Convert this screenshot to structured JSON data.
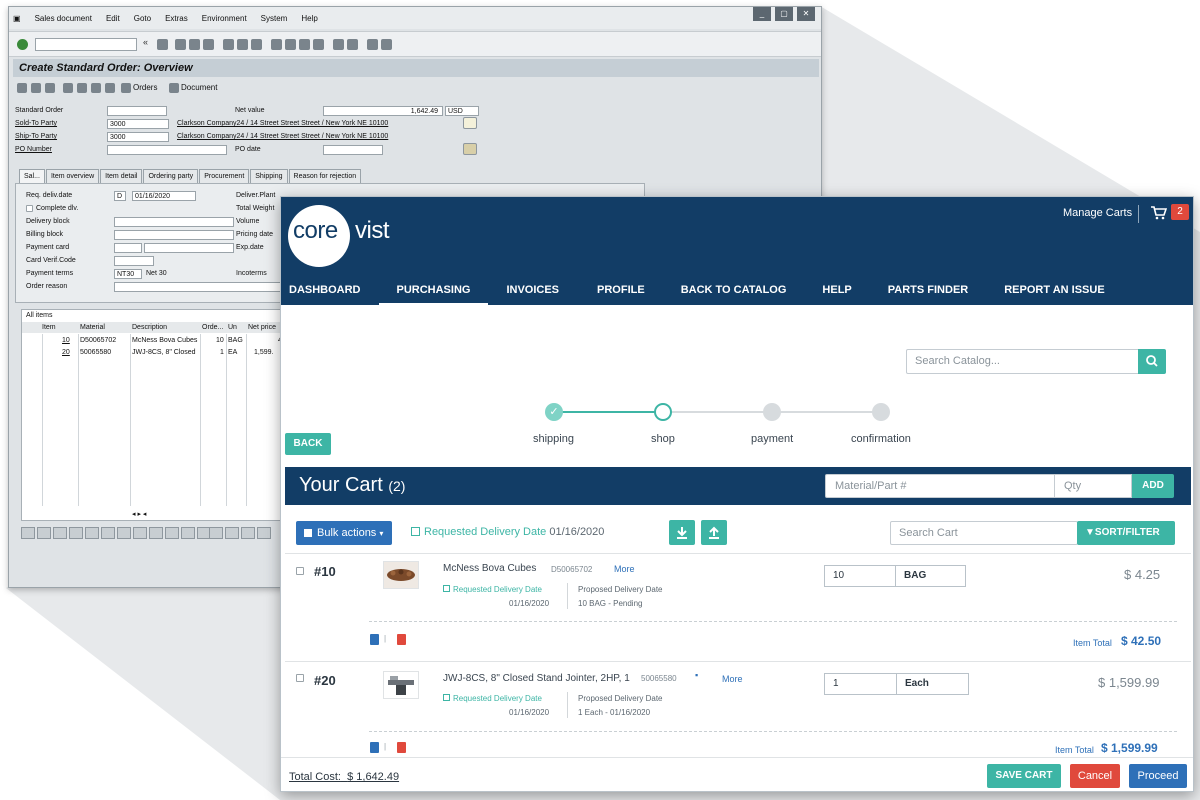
{
  "sap": {
    "menu": [
      "Sales document",
      "Edit",
      "Goto",
      "Extras",
      "Environment",
      "System",
      "Help"
    ],
    "title": "Create Standard Order: Overview",
    "app_toolbar": {
      "orders": "Orders",
      "document": "Document"
    },
    "header_fields": {
      "standard_order_label": "Standard Order",
      "net_value_label": "Net value",
      "net_value": "1,642.49",
      "currency": "USD",
      "sold_to_label": "Sold-To Party",
      "sold_to_value": "3000",
      "sold_to_address": "Clarkson Company24 / 14 Street Street Street / New York NE 10100",
      "ship_to_label": "Ship-To Party",
      "ship_to_value": "3000",
      "ship_to_address": "Clarkson Company24 / 14 Street Street Street / New York NE 10100",
      "po_number_label": "PO Number",
      "po_date_label": "PO date"
    },
    "tabs": [
      "Sal...",
      "Item overview",
      "Item detail",
      "Ordering party",
      "Procurement",
      "Shipping",
      "Reason for rejection"
    ],
    "tab_fields": {
      "req_deliv_label": "Req. deliv.date",
      "req_deliv_type": "D",
      "req_deliv_date": "01/16/2020",
      "complete_div": "Complete dlv.",
      "delivery_block": "Delivery block",
      "billing_block": "Billing block",
      "payment_card": "Payment card",
      "card_verif": "Card Verif.Code",
      "payment_terms_label": "Payment terms",
      "payment_terms_value": "NT30",
      "payment_terms_text": "Net 30",
      "order_reason": "Order reason",
      "deliver_plant": "Deliver.Plant",
      "total_weight": "Total Weight",
      "volume": "Volume",
      "pricing_date": "Pricing date",
      "exp_date": "Exp.date",
      "incoterms": "Incoterms"
    },
    "grid": {
      "title": "All items",
      "headers": [
        "Item",
        "Material",
        "Description",
        "Orde...",
        "Un",
        "Net price"
      ],
      "rows": [
        [
          "10",
          "D50065702",
          "McNess Bova Cubes",
          "10",
          "BAG",
          "4."
        ],
        [
          "20",
          "50065580",
          "JWJ-8CS, 8\" Closed",
          "1",
          "EA",
          "1,599."
        ]
      ]
    }
  },
  "app": {
    "logo_left": "core",
    "logo_right": "vist",
    "manage_carts": "Manage Carts",
    "cart_badge": "2",
    "nav": [
      "DASHBOARD",
      "PURCHASING",
      "INVOICES",
      "PROFILE",
      "BACK TO CATALOG",
      "HELP",
      "PARTS FINDER",
      "REPORT AN ISSUE"
    ],
    "search_placeholder": "Search Catalog...",
    "back": "BACK",
    "steps": [
      "shipping",
      "shop",
      "payment",
      "confirmation"
    ],
    "cart_title": "Your Cart",
    "cart_count": "(2)",
    "material_placeholder": "Material/Part #",
    "qty_placeholder": "Qty",
    "add": "ADD",
    "bulk_actions": "Bulk actions",
    "requested_delivery_label": "Requested Delivery Date",
    "requested_delivery_date": "01/16/2020",
    "search_cart_placeholder": "Search Cart",
    "sort_filter": "SORT/FILTER",
    "items": [
      {
        "num": "#10",
        "description": "McNess Bova Cubes",
        "material": "D50065702",
        "more": "More",
        "rdd_label": "Requested Delivery Date",
        "rdd": "01/16/2020",
        "pdd_label": "Proposed Delivery Date",
        "pdd": "10 BAG - Pending",
        "qty": "10",
        "uom": "BAG",
        "price": "$ 4.25",
        "total_label": "Item Total",
        "total": "$ 42.50"
      },
      {
        "num": "#20",
        "description": "JWJ-8CS, 8\" Closed Stand Jointer, 2HP, 1",
        "material": "50065580",
        "more": "More",
        "rdd_label": "Requested Delivery Date",
        "rdd": "01/16/2020",
        "pdd_label": "Proposed Delivery Date",
        "pdd": "1 Each - 01/16/2020",
        "qty": "1",
        "uom": "Each",
        "price": "$ 1,599.99",
        "total_label": "Item Total",
        "total": "$ 1,599.99"
      }
    ],
    "total_cost_label": "Total Cost:",
    "total_cost": "$ 1,642.49",
    "save_cart": "SAVE CART",
    "cancel": "Cancel",
    "proceed": "Proceed"
  },
  "colors": {
    "navy": "#123d66",
    "teal": "#3db5a5",
    "blue": "#2e70b8",
    "red": "#e0493c"
  }
}
